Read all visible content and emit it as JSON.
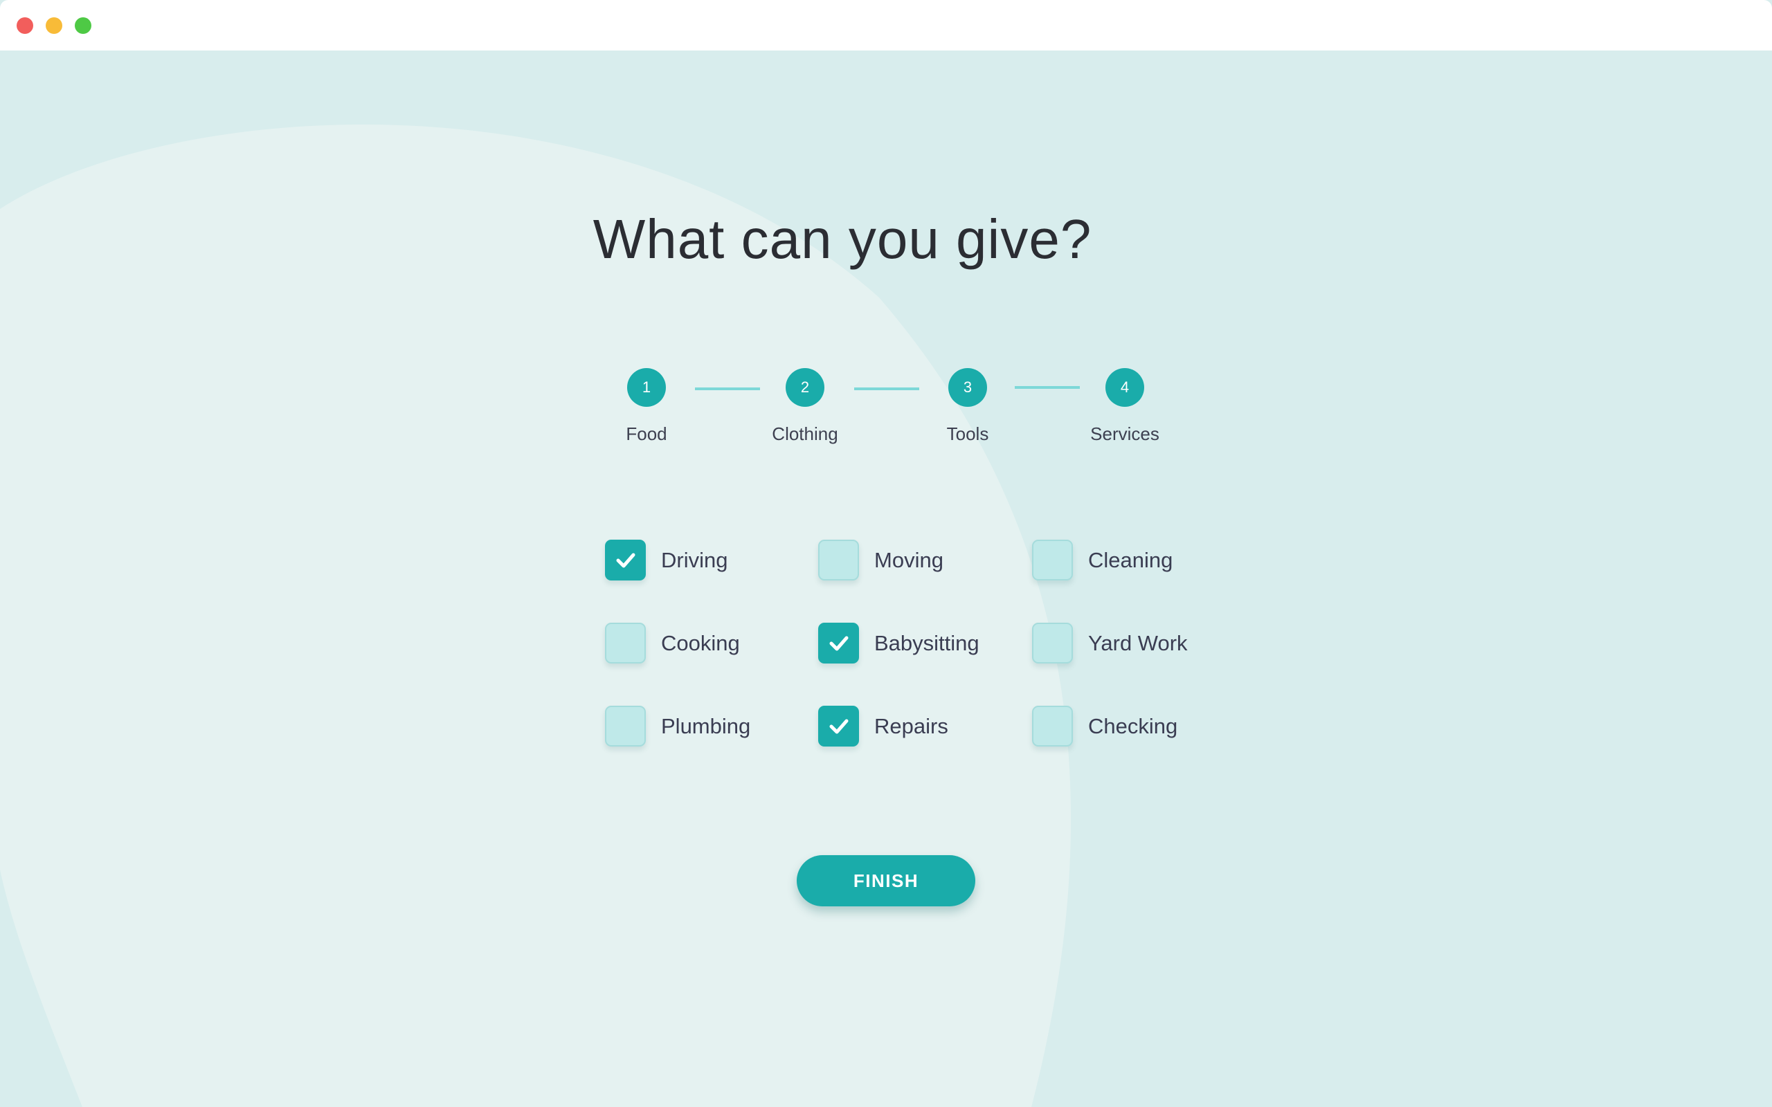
{
  "window": {
    "controls": {
      "close_color": "#f25e5c",
      "minimize_color": "#f8bb38",
      "zoom_color": "#4ec945"
    }
  },
  "title": "What can you give?",
  "steps": [
    {
      "number": "1",
      "label": "Food"
    },
    {
      "number": "2",
      "label": "Clothing"
    },
    {
      "number": "3",
      "label": "Tools"
    },
    {
      "number": "4",
      "label": "Services"
    }
  ],
  "options": [
    {
      "label": "Driving",
      "checked": true
    },
    {
      "label": "Moving",
      "checked": false
    },
    {
      "label": "Cleaning",
      "checked": false
    },
    {
      "label": "Cooking",
      "checked": false
    },
    {
      "label": "Babysitting",
      "checked": true
    },
    {
      "label": "Yard Work",
      "checked": false
    },
    {
      "label": "Plumbing",
      "checked": false
    },
    {
      "label": "Repairs",
      "checked": true
    },
    {
      "label": "Checking",
      "checked": false
    }
  ],
  "finish_label": "FINISH",
  "colors": {
    "accent": "#1aacaa",
    "background": "#d8eded",
    "blob": "#e5f2f1"
  }
}
